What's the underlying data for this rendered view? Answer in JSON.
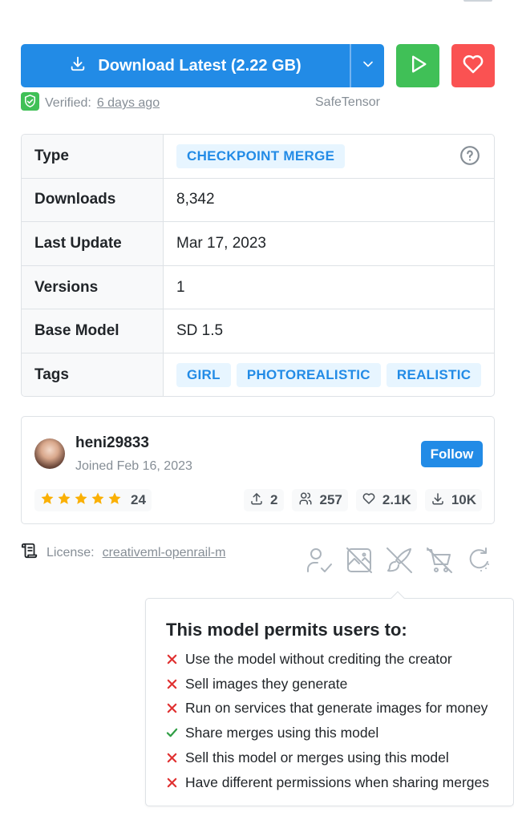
{
  "download": {
    "label": "Download Latest (2.22 GB)"
  },
  "verified": {
    "prefix": "Verified:",
    "link": "6 days ago",
    "format": "SafeTensor"
  },
  "details": {
    "type_label": "Type",
    "type_value": "CHECKPOINT MERGE",
    "downloads_label": "Downloads",
    "downloads_value": "8,342",
    "last_update_label": "Last Update",
    "last_update_value": "Mar 17, 2023",
    "versions_label": "Versions",
    "versions_value": "1",
    "base_model_label": "Base Model",
    "base_model_value": "SD 1.5",
    "tags_label": "Tags",
    "tags": [
      "GIRL",
      "PHOTOREALISTIC",
      "REALISTIC"
    ]
  },
  "creator": {
    "username": "heni29833",
    "joined": "Joined Feb 16, 2023",
    "follow_label": "Follow",
    "rating": 5,
    "rating_count": "24",
    "uploads": "2",
    "followers": "257",
    "likes": "2.1K",
    "downloads": "10K"
  },
  "license": {
    "prefix": "License:",
    "link": "creativeml-openrail-m"
  },
  "permissions": {
    "title": "This model permits users to:",
    "items": [
      {
        "text": "Use the model without crediting the creator",
        "allowed": false
      },
      {
        "text": "Sell images they generate",
        "allowed": false
      },
      {
        "text": "Run on services that generate images for money",
        "allowed": false
      },
      {
        "text": "Share merges using this model",
        "allowed": true
      },
      {
        "text": "Sell this model or merges using this model",
        "allowed": false
      },
      {
        "text": "Have different permissions when sharing merges",
        "allowed": false
      }
    ]
  },
  "colors": {
    "primary": "#228be6",
    "success": "#40c057",
    "danger": "#fa5252",
    "star": "#fab005",
    "deny": "#e03131",
    "allow": "#2f9e44"
  }
}
